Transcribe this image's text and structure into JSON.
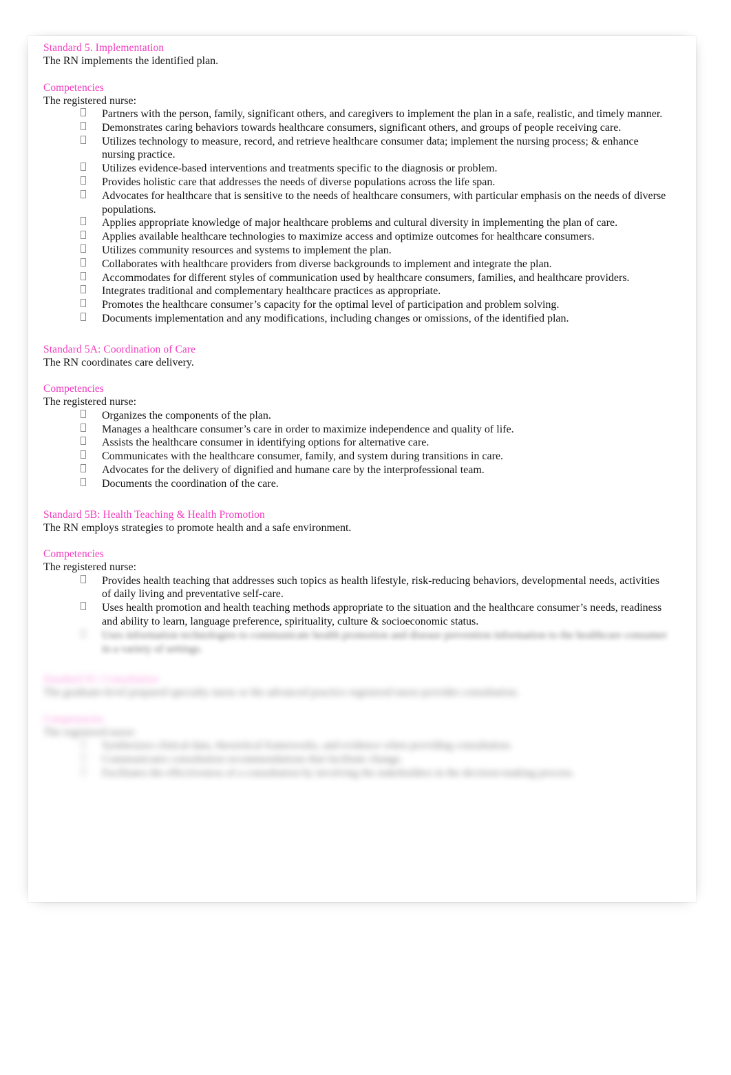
{
  "document": {
    "sections": [
      {
        "id": "standard-5",
        "heading": "Standard 5. Implementation",
        "statement": "The RN implements the identified plan.",
        "competencies_label": "Competencies",
        "intro": "The registered nurse:",
        "blur": "none",
        "items": [
          "Partners with the person, family, significant others, and caregivers to implement the plan in a safe, realistic, and timely manner.",
          "Demonstrates caring behaviors towards healthcare consumers, significant others, and groups of people receiving care.",
          "Utilizes technology to measure, record, and retrieve healthcare consumer data; implement the nursing process; & enhance nursing practice.",
          "Utilizes evidence-based interventions and treatments specific to the diagnosis or problem.",
          "Provides holistic care that addresses the needs of diverse populations across the life span.",
          "Advocates for healthcare that is sensitive to the needs of healthcare consumers, with particular emphasis on the needs of diverse populations.",
          "Applies appropriate knowledge of major healthcare problems and cultural diversity in implementing the plan of care.",
          "Applies available healthcare technologies to maximize access and optimize outcomes for healthcare consumers.",
          "Utilizes community resources and systems to implement the plan.",
          "Collaborates with healthcare providers from diverse backgrounds to implement and integrate the plan.",
          "Accommodates for different styles of communication used by healthcare consumers, families, and healthcare providers.",
          "Integrates traditional and complementary healthcare practices as appropriate.",
          "Promotes the healthcare consumer’s capacity for the optimal level of participation and problem solving.",
          "Documents implementation and any modifications, including changes or omissions, of the identified plan."
        ]
      },
      {
        "id": "standard-5a",
        "heading": "Standard 5A: Coordination of Care",
        "statement": "The RN coordinates care delivery.",
        "competencies_label": "Competencies",
        "intro": "The registered nurse:",
        "blur": "none",
        "items": [
          "Organizes the components of the plan.",
          "Manages a healthcare consumer’s care in order to maximize independence and quality of life.",
          "Assists the healthcare consumer in identifying options for alternative care.",
          "Communicates with the healthcare consumer, family, and system during transitions in care.",
          "Advocates for the delivery of dignified and humane care by the interprofessional team.",
          "Documents the coordination of the care."
        ]
      },
      {
        "id": "standard-5b",
        "heading": "Standard 5B: Health Teaching & Health Promotion",
        "statement": "The RN employs strategies to promote health and a safe environment.",
        "competencies_label": "Competencies",
        "intro": "The registered nurse:",
        "blur": "none",
        "items": [
          "Provides health teaching that addresses such topics as health lifestyle, risk-reducing behaviors, developmental needs, activities of daily living and preventative self-care.",
          "Uses health promotion and health teaching methods appropriate to the situation and the healthcare consumer’s needs, readiness and ability to learn, language preference, spirituality, culture & socioeconomic status."
        ]
      }
    ],
    "obscured": {
      "note": "Remaining page content is blurred in the preview and is not legible.",
      "trailing_item": "Uses information technologies to communicate health promotion and disease prevention information to the healthcare consumer in a variety of settings.",
      "sections": [
        {
          "id": "obscured-standard-heading",
          "heading": "Standard 5C: Consultation",
          "statement": "The graduate-level prepared specialty nurse or the advanced practice registered nurse provides consultation.",
          "competencies_label": "Competencies",
          "intro": "The registered nurse:",
          "items": [
            "Synthesizes clinical data, theoretical frameworks, and evidence when providing consultation.",
            "Communicates consultation recommendations that facilitate change.",
            "Facilitates the effectiveness of a consultation by involving the stakeholders in the decision-making process."
          ]
        }
      ]
    }
  }
}
